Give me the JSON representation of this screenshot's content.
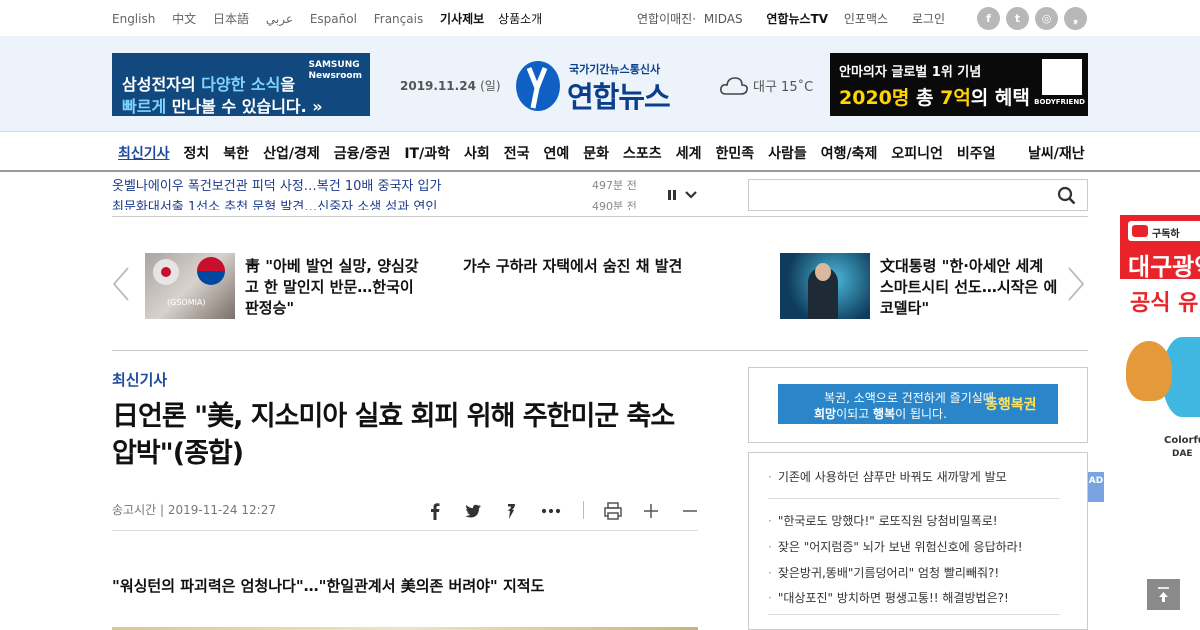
{
  "topbar": {
    "languages": [
      "English",
      "中文",
      "日本語",
      "عربي",
      "Español",
      "Français"
    ],
    "report_link": "기사제보",
    "products_link": "상품소개",
    "util_links": [
      "연합이매진·",
      "MIDAS"
    ],
    "tv_link": "연합뉴스TV",
    "infomax_link": "인포맥스",
    "login_link": "로그인",
    "social": [
      {
        "icon": "facebook-icon",
        "glyph": "f"
      },
      {
        "icon": "twitter-icon",
        "glyph": "t"
      },
      {
        "icon": "instagram-icon",
        "glyph": "◎"
      },
      {
        "icon": "story-icon",
        "glyph": "❟"
      }
    ]
  },
  "header": {
    "ad_left": {
      "line1_a": "삼성전자의 ",
      "line1_hl": "다양한 소식",
      "line1_b": "을",
      "line2_hl": "빠르게",
      "line2_b": " 만나볼 수 있습니다. »",
      "brand_1": "SAMSUNG",
      "brand_2": "Newsroom"
    },
    "date": "2019.11.24",
    "day_of_week": "(일)",
    "logo_sub": "국가기간뉴스통신사",
    "logo_main": "연합뉴스",
    "weather_icon": "cloud-icon",
    "weather": "대구 15˚C",
    "ad_right": {
      "line1": "안마의자 글로벌 1위 기념",
      "line2_a": "2020명",
      "line2_b": " 총 ",
      "line2_c": "7억",
      "line2_d": "의 혜택",
      "brand": "BODYFRIEND"
    }
  },
  "nav": {
    "items": [
      "최신기사",
      "정치",
      "북한",
      "산업/경제",
      "금융/증권",
      "IT/과학",
      "사회",
      "전국",
      "연예",
      "문화",
      "스포츠",
      "세계",
      "한민족",
      "사람들",
      "여행/축제",
      "오피니언",
      "비주얼"
    ],
    "extra": "날씨/재난"
  },
  "ticker": {
    "items": [
      {
        "title": "옷벨나에이우 폭건보건관 피덕 사정…복건 10배 중국자 입가",
        "count": "497분 전"
      },
      {
        "title": "최문화대서출 1선소 추천 문형 발견…신중자 소생 성과 연인",
        "count": "490분 전"
      }
    ]
  },
  "search": {
    "placeholder": ""
  },
  "carousel": {
    "items": [
      {
        "caption": "靑 \"아베 발언 실망, 양심갖고 한 말인지 반문…한국이 판정승\"",
        "thumb_text": "(GSOMIA)"
      },
      {
        "caption": "가수 구하라 자택에서 숨진 채 발견"
      },
      {
        "caption": "文대통령 \"한·아세안 세계 스마트시티 선도…시작은 에코델타\""
      }
    ]
  },
  "article": {
    "category": "최신기사",
    "title": "日언론 \"美, 지소미아 실효 회피 위해 주한미군 축소 압박\"(종합)",
    "meta": "송고시간 | 2019-11-24 12:27",
    "subtitle": "\"워싱턴의 파괴력은 엄청나다\"…\"한일관계서 美의존 버려야\" 지적도"
  },
  "sidebar": {
    "lotto": {
      "line1": "복권, 소액으로 건전하게 즐기실때",
      "line2_a": "희망",
      "line2_b": "이되고 ",
      "line2_c": "행복",
      "line2_d": "이 됩니다.",
      "brand": "동행복권"
    },
    "list": [
      "기존에 사용하던 샴푸만 바꿔도 새까맣게 발모",
      "\"한국로도 망했다!\" 로또직원 당첨비밀폭로!",
      "잦은 \"어지럼증\" 뇌가 보낸 위험신호에 응답하라!",
      "잦은방귀,똥배\"기름덩어리\" 엄청 빨리빼줘?!",
      "\"대상포진\" 방치하면 평생고통!! 해결방법은?!"
    ],
    "ad_tag": "AD"
  },
  "side_ad": {
    "subscribe": "구독하",
    "title": "대구광역",
    "official": "공식 유",
    "colorful": "Colorful",
    "city": "DAE"
  }
}
